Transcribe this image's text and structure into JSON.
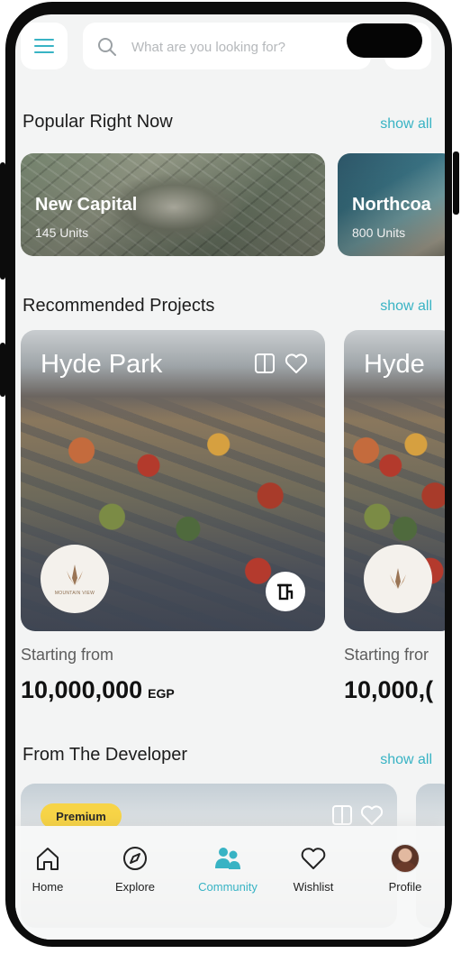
{
  "search": {
    "placeholder": "What are you looking for?"
  },
  "popular": {
    "title": "Popular Right Now",
    "show_all": "show all",
    "cards": [
      {
        "name": "New Capital",
        "units": "145 Units"
      },
      {
        "name": "Northcoa",
        "units": "800 Units"
      }
    ]
  },
  "recommended": {
    "title": "Recommended Projects",
    "show_all": "show all",
    "cards": [
      {
        "name": "Hyde Park",
        "starting_label": "Starting from",
        "price": "10,000,000",
        "currency": "EGP",
        "logo_text": "MOUNTAIN VIEW"
      },
      {
        "name": "Hyde",
        "starting_label": "Starting fror",
        "price": "10,000,("
      }
    ]
  },
  "developer": {
    "title": "From The Developer",
    "show_all": "show all",
    "badge": "Premium"
  },
  "nav": {
    "items": [
      {
        "label": "Home",
        "icon": "home-icon"
      },
      {
        "label": "Explore",
        "icon": "compass-icon"
      },
      {
        "label": "Community",
        "icon": "community-icon",
        "active": true
      },
      {
        "label": "Wishlist",
        "icon": "heart-icon"
      },
      {
        "label": "Profile",
        "icon": "avatar"
      }
    ]
  },
  "colors": {
    "accent": "#38b3c4",
    "badge": "#f7d447"
  }
}
